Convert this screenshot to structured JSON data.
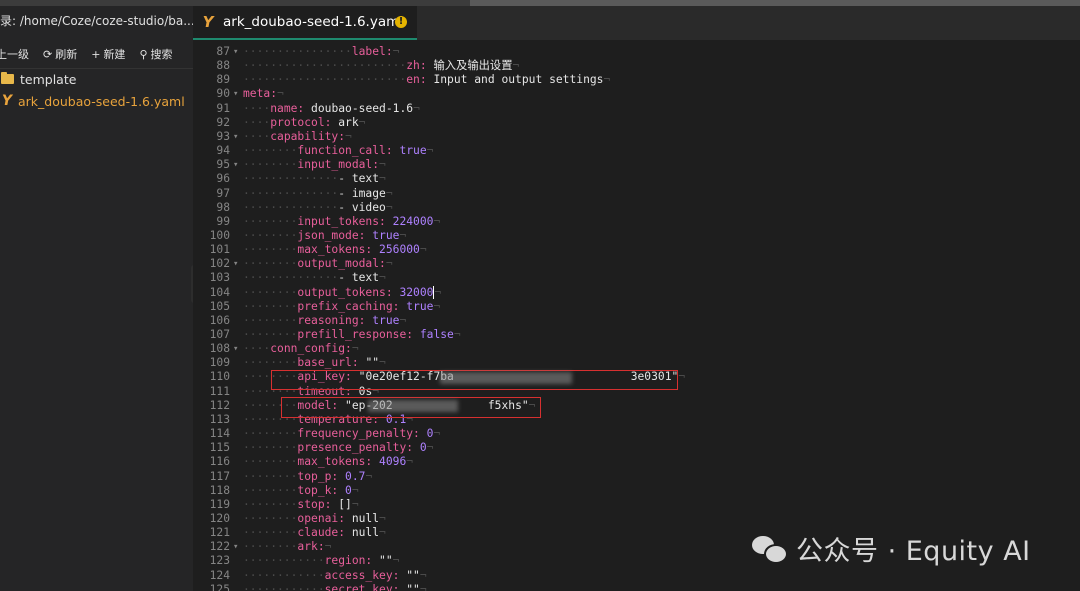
{
  "sidebar": {
    "path_label": "录: /home/Coze/coze-studio/ba...",
    "tools": [
      {
        "icon": "arrow-up-icon",
        "label": "上一级"
      },
      {
        "icon": "refresh-icon",
        "label": "刷新"
      },
      {
        "icon": "plus-icon",
        "label": "新建"
      },
      {
        "icon": "search-icon",
        "label": "搜索"
      }
    ],
    "tree": [
      {
        "type": "folder",
        "label": "template"
      },
      {
        "type": "yaml-file",
        "label": "ark_doubao-seed-1.6.yaml"
      }
    ]
  },
  "tab": {
    "title": "ark_doubao-seed-1.6.yaml",
    "warning_glyph": "!"
  },
  "editor": {
    "lines": [
      {
        "n": "87",
        "indent": 4,
        "key": "label:",
        "val": "",
        "fold": true
      },
      {
        "n": "88",
        "indent": 6,
        "key": "zh:",
        "val": " 输入及输出设置"
      },
      {
        "n": "89",
        "indent": 6,
        "key": "en:",
        "val": " Input and output settings"
      },
      {
        "n": "90",
        "indent": 0,
        "key": "meta:",
        "val": "",
        "fold": true
      },
      {
        "n": "91",
        "indent": 1,
        "key": "name:",
        "val": " doubao-seed-1.6"
      },
      {
        "n": "92",
        "indent": 1,
        "key": "protocol:",
        "val": " ark"
      },
      {
        "n": "93",
        "indent": 1,
        "key": "capability:",
        "val": "",
        "fold": true
      },
      {
        "n": "94",
        "indent": 2,
        "key": "function_call:",
        "val": " true",
        "vtype": "b"
      },
      {
        "n": "95",
        "indent": 2,
        "key": "input_modal:",
        "val": "",
        "fold": true
      },
      {
        "n": "96",
        "indent": 3,
        "key": "- ",
        "val": "text"
      },
      {
        "n": "97",
        "indent": 3,
        "key": "- ",
        "val": "image"
      },
      {
        "n": "98",
        "indent": 3,
        "key": "- ",
        "val": "video"
      },
      {
        "n": "99",
        "indent": 2,
        "key": "input_tokens:",
        "val": " 224000",
        "vtype": "n"
      },
      {
        "n": "100",
        "indent": 2,
        "key": "json_mode:",
        "val": " true",
        "vtype": "b"
      },
      {
        "n": "101",
        "indent": 2,
        "key": "max_tokens:",
        "val": " 256000",
        "vtype": "n"
      },
      {
        "n": "102",
        "indent": 2,
        "key": "output_modal:",
        "val": "",
        "fold": true
      },
      {
        "n": "103",
        "indent": 3,
        "key": "- ",
        "val": "text"
      },
      {
        "n": "104",
        "indent": 2,
        "key": "output_tokens:",
        "val": " 32000",
        "vtype": "n",
        "cursor": true
      },
      {
        "n": "105",
        "indent": 2,
        "key": "prefix_caching:",
        "val": " true",
        "vtype": "b"
      },
      {
        "n": "106",
        "indent": 2,
        "key": "reasoning:",
        "val": " true",
        "vtype": "b"
      },
      {
        "n": "107",
        "indent": 2,
        "key": "prefill_response:",
        "val": " false",
        "vtype": "b"
      },
      {
        "n": "108",
        "indent": 1,
        "key": "conn_config:",
        "val": "",
        "fold": true
      },
      {
        "n": "109",
        "indent": 2,
        "key": "base_url:",
        "val": " \"\""
      },
      {
        "n": "110",
        "indent": 2,
        "key": "api_key:",
        "val": " \"0e20ef12-f7ba                          3e0301\""
      },
      {
        "n": "111",
        "indent": 2,
        "key": "timeout:",
        "val": " 0s"
      },
      {
        "n": "112",
        "indent": 2,
        "key": "model:",
        "val": " \"ep-202              f5xhs\""
      },
      {
        "n": "113",
        "indent": 2,
        "key": "temperature:",
        "val": " 0.1",
        "vtype": "n"
      },
      {
        "n": "114",
        "indent": 2,
        "key": "frequency_penalty:",
        "val": " 0",
        "vtype": "n"
      },
      {
        "n": "115",
        "indent": 2,
        "key": "presence_penalty:",
        "val": " 0",
        "vtype": "n"
      },
      {
        "n": "116",
        "indent": 2,
        "key": "max_tokens:",
        "val": " 4096",
        "vtype": "n"
      },
      {
        "n": "117",
        "indent": 2,
        "key": "top_p:",
        "val": " 0.7",
        "vtype": "n"
      },
      {
        "n": "118",
        "indent": 2,
        "key": "top_k:",
        "val": " 0",
        "vtype": "n"
      },
      {
        "n": "119",
        "indent": 2,
        "key": "stop:",
        "val": " []"
      },
      {
        "n": "120",
        "indent": 2,
        "key": "openai:",
        "val": " null"
      },
      {
        "n": "121",
        "indent": 2,
        "key": "claude:",
        "val": " null"
      },
      {
        "n": "122",
        "indent": 2,
        "key": "ark:",
        "val": "",
        "fold": true
      },
      {
        "n": "123",
        "indent": 3,
        "key": "region:",
        "val": " \"\""
      },
      {
        "n": "124",
        "indent": 3,
        "key": "access_key:",
        "val": " \"\""
      },
      {
        "n": "125",
        "indent": 3,
        "key": "secret_key:",
        "val": " \"\""
      }
    ]
  },
  "watermark": {
    "text": "公众号 · Equity AI"
  },
  "colors": {
    "key": "#e85f9b",
    "number": "#ae81ff",
    "string": "#e6e6e6",
    "highlight_box": "#d63030",
    "tab_accent": "#1e8a6e",
    "folder": "#e8b84a"
  }
}
